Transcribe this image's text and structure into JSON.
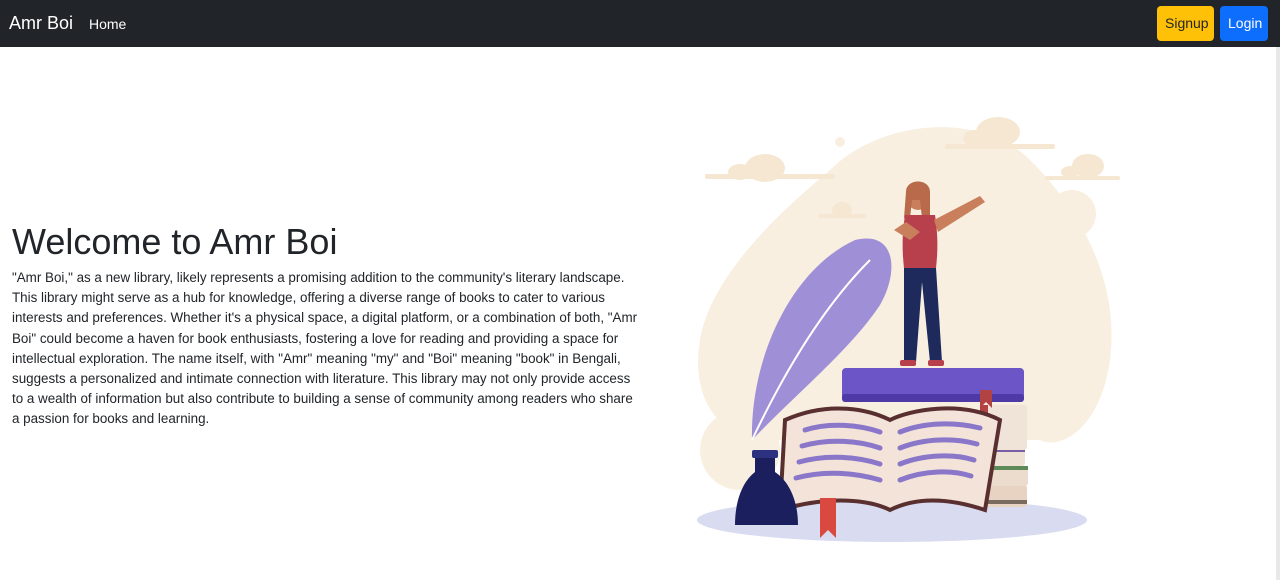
{
  "navbar": {
    "brand": "Amr Boi",
    "links": [
      {
        "label": "Home"
      }
    ],
    "buttons": {
      "signup": "Signup",
      "login": "Login"
    }
  },
  "hero": {
    "title": "Welcome to Amr Boi",
    "description": "\"Amr Boi,\" as a new library, likely represents a promising addition to the community's literary landscape. This library might serve as a hub for knowledge, offering a diverse range of books to cater to various interests and preferences. Whether it's a physical space, a digital platform, or a combination of both, \"Amr Boi\" could become a haven for book enthusiasts, fostering a love for reading and providing a space for intellectual exploration. The name itself, with \"Amr\" meaning \"my\" and \"Boi\" meaning \"book\" in Bengali, suggests a personalized and intimate connection with literature. This library may not only provide access to a wealth of information but also contribute to building a sense of community among readers who share a passion for books and learning."
  },
  "colors": {
    "navbar_bg": "#212529",
    "signup_bg": "#ffc107",
    "login_bg": "#0d6efd",
    "blob": "#f8efe0",
    "feather": "#9f8fd6",
    "book_purple": "#6c55c7",
    "ink": "#1b1f5e"
  }
}
